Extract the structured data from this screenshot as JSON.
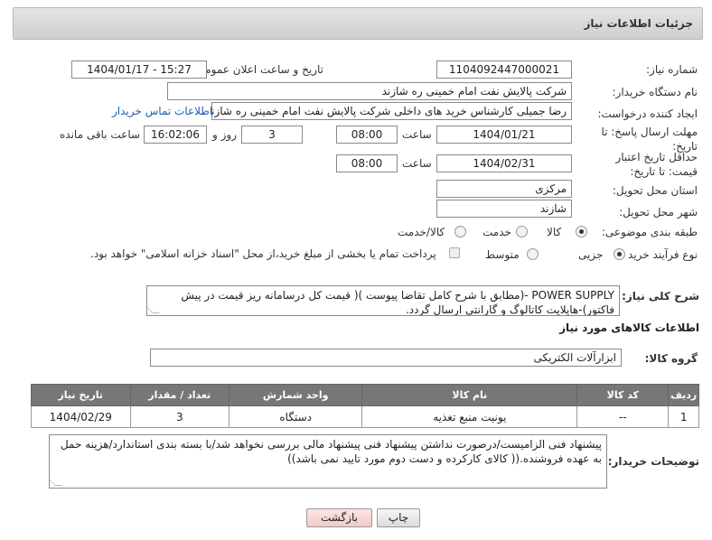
{
  "header": {
    "title": "جزئیات اطلاعات نیاز"
  },
  "fields": {
    "need_number": {
      "label": "شماره نیاز:",
      "value": "1104092447000021"
    },
    "announce_datetime": {
      "label": "تاریخ و ساعت اعلان عمومی:",
      "value": "1404/01/17 - 15:27"
    },
    "buyer_org": {
      "label": "نام دستگاه خریدار:",
      "value": "شرکت پالایش نفت امام خمینی  ره  شازند"
    },
    "requester": {
      "label": "ایجاد کننده درخواست:",
      "value": "رضا جمیلی کارشناس خرید های داخلی  شرکت پالایش نفت امام خمینی  ره  شازند",
      "contact_link": "اطلاعات تماس خریدار"
    },
    "reply_deadline": {
      "label": "مهلت ارسال پاسخ: تا تاریخ:",
      "date": "1404/01/21",
      "time_label": "ساعت",
      "time": "08:00",
      "days": "3",
      "days_label": "روز و",
      "remaining": "16:02:06",
      "remaining_label": "ساعت باقی مانده"
    },
    "price_validity": {
      "label": "حداقل تاریخ اعتبار قیمت: تا تاریخ:",
      "date": "1404/02/31",
      "time_label": "ساعت",
      "time": "08:00"
    },
    "delivery_province": {
      "label": "استان محل تحویل:",
      "value": "مرکزی"
    },
    "delivery_city": {
      "label": "شهر محل تحویل:",
      "value": "شازند"
    },
    "category": {
      "label": "طبقه بندی موضوعی:",
      "options": [
        "کالا",
        "خدمت",
        "کالا/خدمت"
      ],
      "selected": "کالا"
    },
    "process": {
      "label": "نوع فرآیند خرید :",
      "options": [
        "جزیی",
        "متوسط"
      ],
      "selected": "جزیی",
      "note": "پرداخت تمام یا بخشی از مبلغ خرید،از محل \"اسناد خزانه اسلامی\" خواهد بود."
    }
  },
  "general_description": {
    "label": "شرح کلی نیاز:",
    "text": "POWER SUPPLY -(مطابق با شرح کامل تقاضا پیوست )( قیمت کل درسامانه ریز قیمت در پیش فاکتور)-هایلایت کاتالوگ و گارانتی ارسال گردد."
  },
  "goods_info": {
    "title": "اطلاعات کالاهای مورد نیاز",
    "group_label": "گروه کالا:",
    "group_value": "ابزارآلات الکتریکی",
    "columns": [
      "ردیف",
      "کد کالا",
      "نام کالا",
      "واحد شمارش",
      "تعداد / مقدار",
      "تاریخ نیاز"
    ],
    "rows": [
      [
        "1",
        "--",
        "یونیت منبع تغذیه",
        "دستگاه",
        "3",
        "1404/02/29"
      ]
    ]
  },
  "buyer_notes": {
    "label": "توضیحات خریدار:",
    "text": "پیشنهاد فنی الزامیست/درصورت نداشتن پیشنهاد فنی پیشنهاد مالی بررسی نخواهد شد/با بسته بندی استاندارد/هزینه حمل به عهده فروشنده.(( کالای کارکرده و دست دوم مورد تایید نمی باشد))"
  },
  "buttons": {
    "print": "چاپ",
    "back": "بازگشت"
  },
  "colors": {
    "table_header": "#777777",
    "link": "#1a5fb4",
    "back_button": "#f1caca"
  }
}
